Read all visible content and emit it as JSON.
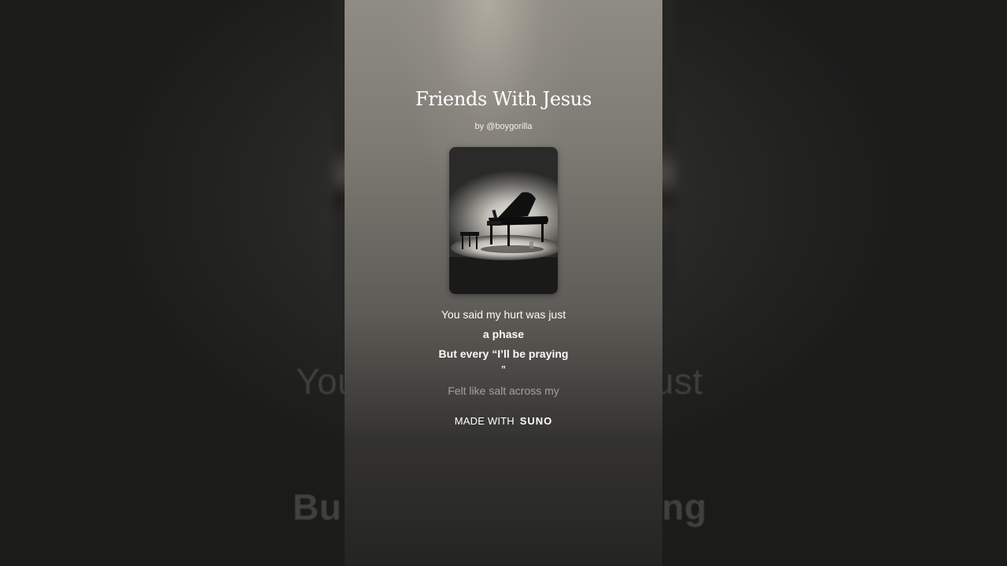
{
  "song": {
    "title": "Friends With Jesus",
    "byline": "by @boygorilla"
  },
  "cover_art": {
    "subject": "grand-piano-icon",
    "colors": {
      "spotlight": "#ecebe6",
      "piano": "#111111"
    }
  },
  "lyrics": {
    "lines": [
      "You said my hurt was just",
      "a phase",
      "But every “I’ll be praying",
      "”",
      "Felt like salt across my"
    ]
  },
  "footer": {
    "made_with_label": "MADE WITH",
    "brand": "SUNO"
  },
  "background": {
    "lyric_fragment_1_left": "You",
    "lyric_fragment_1_right": "just",
    "lyric_fragment_2_left": "Bu",
    "lyric_fragment_2_right": "ing"
  },
  "colors": {
    "text": "#ffffff",
    "background": "#1d1d1c"
  }
}
